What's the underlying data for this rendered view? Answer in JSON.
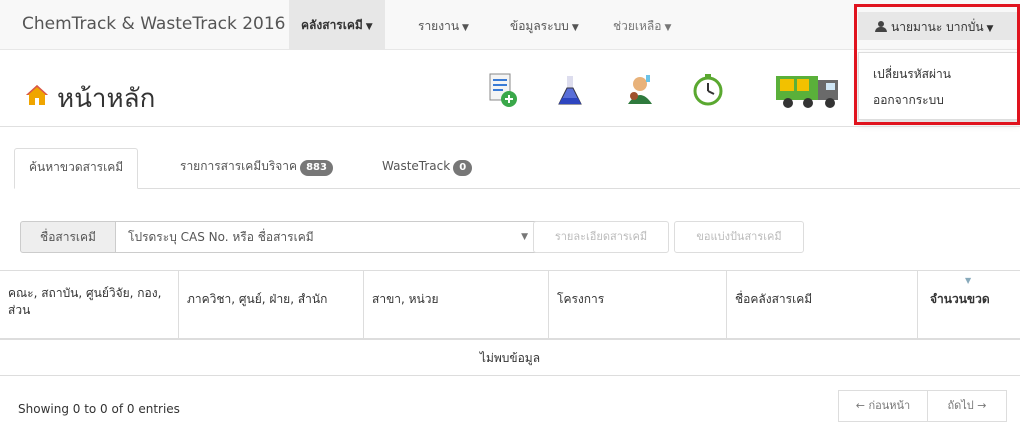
{
  "navbar": {
    "brand": "ChemTrack & WasteTrack 2016",
    "menus": [
      {
        "label": "คลังสารเคมี",
        "active": true
      },
      {
        "label": "รายงาน"
      },
      {
        "label": "ข้อมูลระบบ"
      },
      {
        "label": "ช่วยเหลือ"
      }
    ],
    "user": {
      "name": "นายมานะ บากบั่น",
      "icon": "user-icon",
      "dropdown": [
        "เปลี่ยนรหัสผ่าน",
        "ออกจากระบบ"
      ]
    },
    "highlight_color": "#e0131e"
  },
  "header": {
    "title": "หน้าหลัก",
    "icon": "home-icon",
    "tools": [
      "document-add-icon",
      "flask-icon",
      "scientist-icon",
      "clock-icon",
      "waste-truck-icon"
    ]
  },
  "tabs": [
    {
      "label": "ค้นหาขวดสารเคมี",
      "active": true
    },
    {
      "label": "รายการสารเคมีบริจาค",
      "badge": "883"
    },
    {
      "label": "WasteTrack",
      "badge": "0"
    }
  ],
  "search": {
    "addon_label": "ชื่อสารเคมี",
    "placeholder": "โปรดระบุ CAS No. หรือ ชื่อสารเคมี",
    "buttons": [
      "รายละเอียดสารเคมี",
      "ขอแบ่งปันสารเคมี"
    ]
  },
  "table": {
    "columns": [
      "คณะ, สถาบัน, ศูนย์วิจัย, กอง, ส่วน",
      "ภาควิชา, ศูนย์, ฝ่าย, สำนัก",
      "สาขา, หน่วย",
      "โครงการ",
      "ชื่อคลังสารเคมี",
      "จำนวนขวด"
    ],
    "empty_text": "ไม่พบข้อมูล"
  },
  "footer": {
    "info": "Showing 0 to 0 of 0 entries",
    "prev": "← ก่อนหน้า",
    "next": "ถัดไป →"
  }
}
